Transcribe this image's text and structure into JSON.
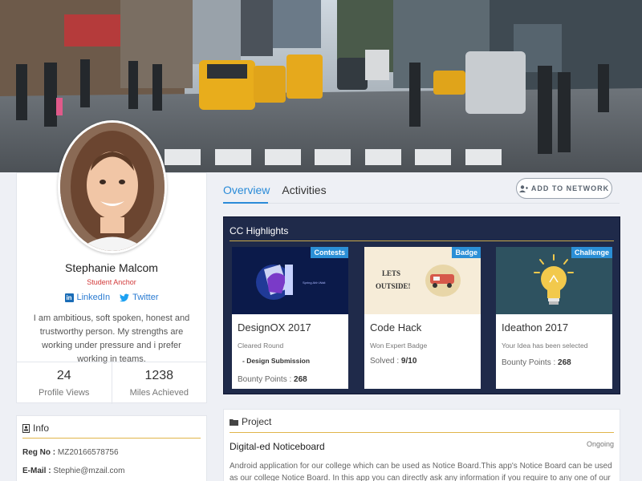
{
  "profile": {
    "name": "Stephanie Malcom",
    "role": "Student Anchor",
    "linkedin_label": "LinkedIn",
    "twitter_label": "Twitter",
    "bio": "I am ambitious, soft spoken, honest and trustworthy person. My strengths are working under pressure and i prefer working in teams.",
    "stats": [
      {
        "value": "24",
        "label": "Profile Views"
      },
      {
        "value": "1238",
        "label": "Miles Achieved"
      }
    ]
  },
  "info": {
    "title": "Info",
    "reg_label": "Reg No :",
    "reg_value": "MZ20166578756",
    "email_label": "E-Mail :",
    "email_value": "Stephie@mzail.com"
  },
  "tabs": [
    "Overview",
    "Activities"
  ],
  "add_network_label": "ADD TO NETWORK",
  "highlights": {
    "title": "CC Highlights",
    "cards": [
      {
        "badge": "Contests",
        "name": "DesignOX 2017",
        "sub": "Cleared Round",
        "extra": "- Design Submission",
        "score_label": "Bounty Points :",
        "score_value": "268"
      },
      {
        "badge": "Badge",
        "name": "Code Hack",
        "sub": "Won Expert Badge",
        "extra": "",
        "score_label": "Solved :",
        "score_value": "9/10"
      },
      {
        "badge": "Challenge",
        "name": "Ideathon 2017",
        "sub": "Your Idea has been selected",
        "extra": "",
        "score_label": "Bounty Points :",
        "score_value": "268"
      }
    ]
  },
  "project": {
    "title": "Project",
    "name": "Digital-ed Noticeboard",
    "status": "Ongoing",
    "description": "Android application for our college which can be used as Notice Board.This app's Notice Board can be used as our college Notice Board. In this app you can directly ask any information if you require to any one of our higher"
  },
  "colors": {
    "accent": "#2a8bd8",
    "navy_panel": "#1f2a4a",
    "gold_rule": "#e0b54a",
    "role_red": "#d23a3a"
  },
  "icons": [
    "linkedin-icon",
    "twitter-icon",
    "user-plus-icon",
    "id-card-icon",
    "folder-icon"
  ]
}
